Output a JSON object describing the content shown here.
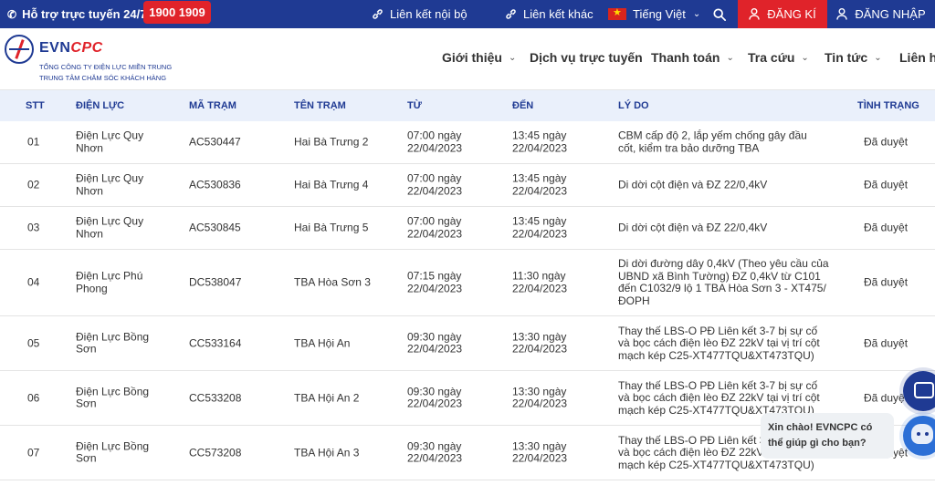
{
  "topbar": {
    "support_label": "Hỗ trợ trực tuyến 24/7:",
    "hotline": "1900 1909",
    "links": [
      "Liên kết nội bộ",
      "Liên kết khác"
    ],
    "language": "Tiếng Việt",
    "register": "ĐĂNG KÍ",
    "login": "ĐĂNG NHẬP",
    "colors": {
      "bar": "#1f3a93",
      "accent": "#e0232a"
    }
  },
  "header": {
    "brand_evn": "EVN",
    "brand_cpc": "CPC",
    "company_line1": "TỔNG CÔNG TY ĐIỆN LỰC MIỀN TRUNG",
    "company_line2": "TRUNG TÂM CHĂM SÓC KHÁCH HÀNG",
    "nav": [
      "Giới thiệu",
      "Dịch vụ trực tuyến",
      "Thanh toán",
      "Tra cứu",
      "Tin tức",
      "Liên hệ"
    ]
  },
  "table": {
    "headers": [
      "STT",
      "ĐIỆN LỰC",
      "MÃ TRẠM",
      "TÊN TRẠM",
      "TỪ",
      "ĐẾN",
      "LÝ DO",
      "TÌNH TRẠNG"
    ],
    "rows": [
      {
        "stt": "01",
        "dl1": "Điện Lực Quy",
        "dl2": "Nhơn",
        "ma": "AC530447",
        "ten": "Hai Bà Trưng 2",
        "tu1": "07:00 ngày",
        "tu2": "22/04/2023",
        "den1": "13:45 ngày",
        "den2": "22/04/2023",
        "lydo": [
          "CBM cấp độ 2, lắp yếm chống gây đầu",
          "cốt, kiểm tra bảo dưỡng TBA"
        ],
        "status": "Đã duyệt"
      },
      {
        "stt": "02",
        "dl1": "Điện Lực Quy",
        "dl2": "Nhơn",
        "ma": "AC530836",
        "ten": "Hai Bà Trưng 4",
        "tu1": "07:00 ngày",
        "tu2": "22/04/2023",
        "den1": "13:45 ngày",
        "den2": "22/04/2023",
        "lydo": [
          "Di dời cột điện và ĐZ 22/0,4kV"
        ],
        "status": "Đã duyệt"
      },
      {
        "stt": "03",
        "dl1": "Điện Lực Quy",
        "dl2": "Nhơn",
        "ma": "AC530845",
        "ten": "Hai Bà Trưng 5",
        "tu1": "07:00 ngày",
        "tu2": "22/04/2023",
        "den1": "13:45 ngày",
        "den2": "22/04/2023",
        "lydo": [
          "Di dời cột điện và ĐZ 22/0,4kV"
        ],
        "status": "Đã duyệt"
      },
      {
        "stt": "04",
        "dl1": "Điện Lực Phú",
        "dl2": "Phong",
        "ma": "DC538047",
        "ten": "TBA Hòa Sơn 3",
        "tu1": "07:15 ngày",
        "tu2": "22/04/2023",
        "den1": "11:30 ngày",
        "den2": "22/04/2023",
        "lydo": [
          "Di dời đường dây 0,4kV (Theo yêu cầu của",
          "UBND xã Bình Tường) ĐZ 0,4kV từ C101",
          "đến C1032/9 lộ 1 TBA Hòa Sơn 3 - XT475/",
          "ĐOPH"
        ],
        "status": "Đã duyệt"
      },
      {
        "stt": "05",
        "dl1": "Điện Lực Bồng",
        "dl2": "Sơn",
        "ma": "CC533164",
        "ten": "TBA Hội An",
        "tu1": "09:30 ngày",
        "tu2": "22/04/2023",
        "den1": "13:30 ngày",
        "den2": "22/04/2023",
        "lydo": [
          "Thay thế LBS-O PĐ Liên kết 3-7 bị sự cố",
          "và bọc cách điện lèo ĐZ 22kV tại vị trí cột",
          "mạch kép C25-XT477TQU&XT473TQU)"
        ],
        "status": "Đã duyệt"
      },
      {
        "stt": "06",
        "dl1": "Điện Lực Bồng",
        "dl2": "Sơn",
        "ma": "CC533208",
        "ten": "TBA Hội An 2",
        "tu1": "09:30 ngày",
        "tu2": "22/04/2023",
        "den1": "13:30 ngày",
        "den2": "22/04/2023",
        "lydo": [
          "Thay thế LBS-O PĐ Liên kết 3-7 bị sự cố",
          "và bọc cách điện lèo ĐZ 22kV tại vị trí cột",
          "mạch kép C25-XT477TQU&XT473TQU)"
        ],
        "status": "Đã duyệt"
      },
      {
        "stt": "07",
        "dl1": "Điện Lực Bồng",
        "dl2": "Sơn",
        "ma": "CC573208",
        "ten": "TBA Hội An 3",
        "tu1": "09:30 ngày",
        "tu2": "22/04/2023",
        "den1": "13:30 ngày",
        "den2": "22/04/2023",
        "lydo": [
          "Thay thế LBS-O PĐ Liên kết 3-7 bị sự cố",
          "và bọc cách điện lèo ĐZ 22kV tại vị trí cột",
          "mạch kép C25-XT477TQU&XT473TQU)"
        ],
        "status": "Đã duyệt"
      }
    ]
  },
  "chat": {
    "line1": "Xin chào! EVNCPC có",
    "line2": "thể giúp gì cho bạn?"
  }
}
